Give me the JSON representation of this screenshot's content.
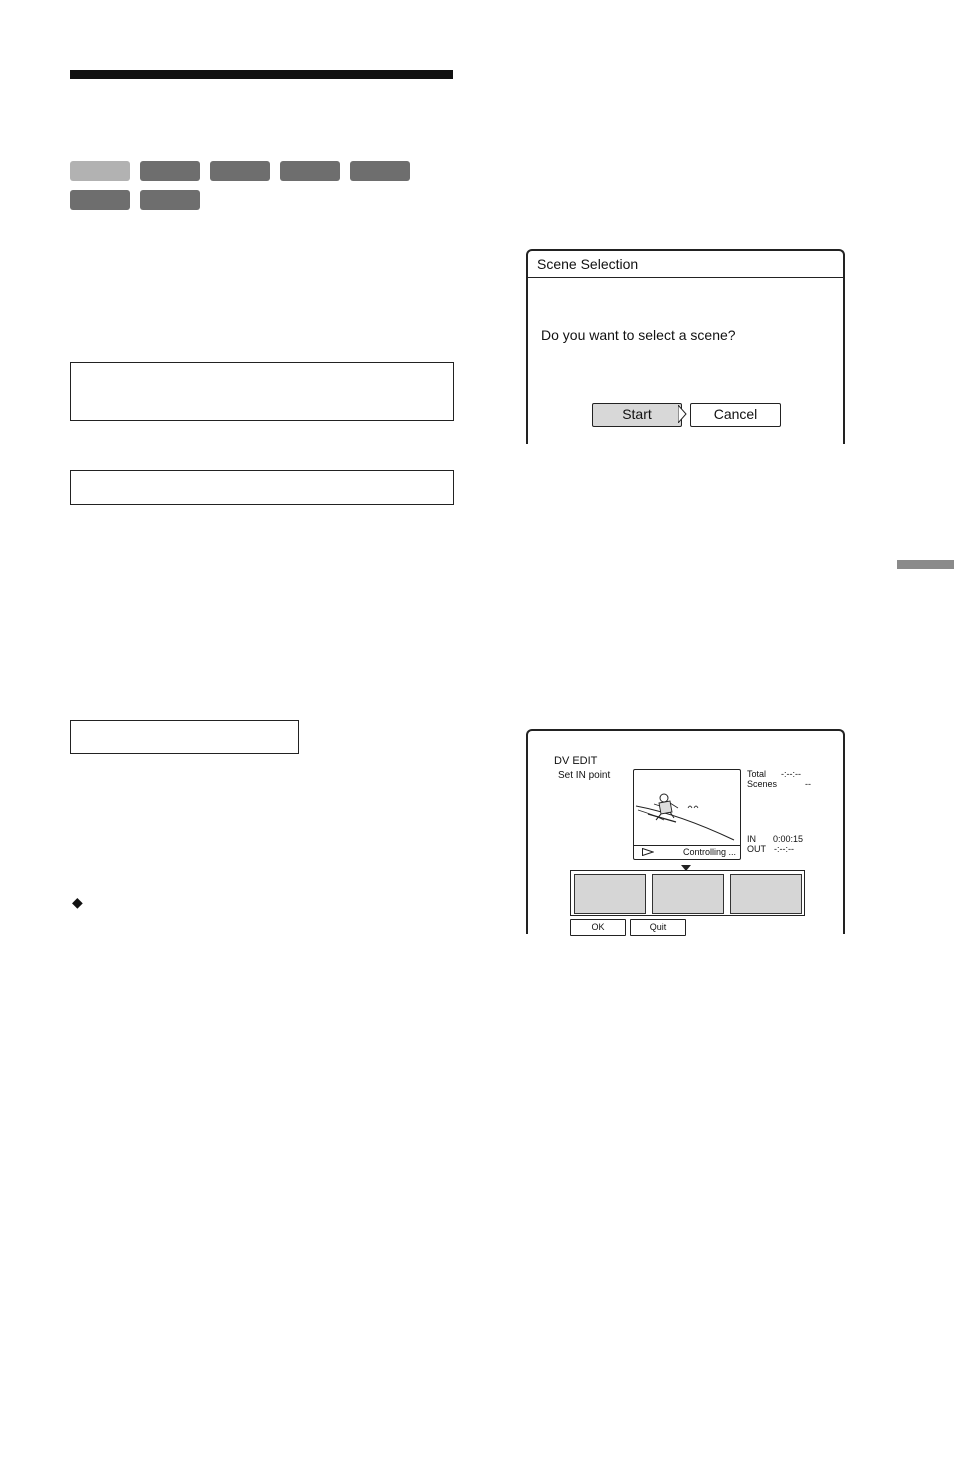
{
  "page": {
    "format_badges": [
      {
        "label": "",
        "highlighted": true
      },
      {
        "label": "",
        "highlighted": false
      },
      {
        "label": "",
        "highlighted": false
      },
      {
        "label": "",
        "highlighted": false
      },
      {
        "label": "",
        "highlighted": false
      },
      {
        "label": "",
        "highlighted": false
      },
      {
        "label": "",
        "highlighted": false
      }
    ],
    "bullet_symbol": "◆"
  },
  "scene_dialog": {
    "title": "Scene Selection",
    "question": "Do you want to select a scene?",
    "start_label": "Start",
    "cancel_label": "Cancel",
    "focused_button": "Start"
  },
  "dv_edit": {
    "title": "DV EDIT",
    "subtitle": "Set IN point",
    "total_label": "Total",
    "total_value": "-:--:--",
    "scenes_label": "Scenes",
    "scenes_value": "--",
    "in_label": "IN",
    "in_value": "0:00:15",
    "out_label": "OUT",
    "out_value": "-:--:--",
    "status_text": "Controlling ...",
    "ok_label": "OK",
    "quit_label": "Quit"
  }
}
